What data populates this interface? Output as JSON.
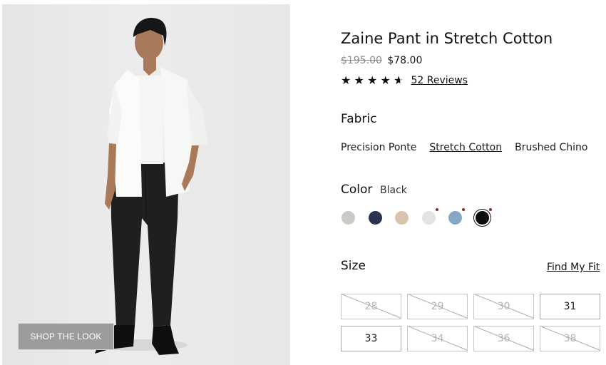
{
  "product": {
    "title": "Zaine Pant in Stretch Cotton",
    "original_price": "$195.00",
    "sale_price": "$78.00",
    "rating": 4.5,
    "reviews_label": "52 Reviews",
    "shop_the_look": "SHOP THE LOOK"
  },
  "fabric": {
    "heading": "Fabric",
    "options": [
      {
        "label": "Precision Ponte",
        "selected": false
      },
      {
        "label": "Stretch Cotton",
        "selected": true
      },
      {
        "label": "Brushed Chino",
        "selected": false
      }
    ]
  },
  "color": {
    "heading": "Color",
    "selected_name": "Black",
    "swatches": [
      {
        "color": "#c8cbc6",
        "sale": false,
        "selected": false
      },
      {
        "color": "#2b3150",
        "sale": false,
        "selected": false
      },
      {
        "color": "#d8c4ad",
        "sale": false,
        "selected": false
      },
      {
        "color": "#e3e3e3",
        "sale": true,
        "selected": false
      },
      {
        "color": "#86a7c6",
        "sale": true,
        "selected": false
      },
      {
        "color": "#0d0d0d",
        "sale": true,
        "selected": true
      }
    ],
    "sale_dot_color": "#8a2d1c"
  },
  "size": {
    "heading": "Size",
    "find_fit_label": "Find My Fit",
    "options": [
      {
        "label": "28",
        "available": false
      },
      {
        "label": "29",
        "available": false
      },
      {
        "label": "30",
        "available": false
      },
      {
        "label": "31",
        "available": true
      },
      {
        "label": "33",
        "available": true
      },
      {
        "label": "34",
        "available": false
      },
      {
        "label": "36",
        "available": false
      },
      {
        "label": "38",
        "available": false
      }
    ]
  }
}
